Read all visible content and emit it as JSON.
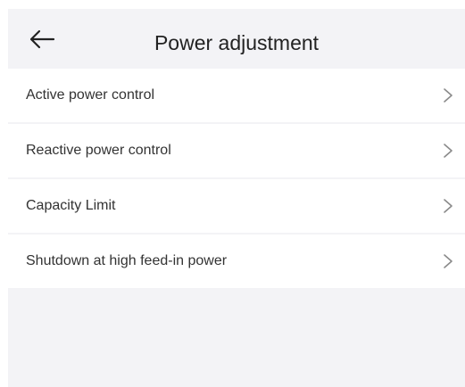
{
  "header": {
    "title": "Power adjustment",
    "back_icon": "arrow-left-icon"
  },
  "menu": {
    "items": [
      {
        "label": "Active power control",
        "icon": "chevron-right-icon"
      },
      {
        "label": "Reactive power control",
        "icon": "chevron-right-icon"
      },
      {
        "label": "Capacity Limit",
        "icon": "chevron-right-icon"
      },
      {
        "label": "Shutdown at high feed-in power",
        "icon": "chevron-right-icon"
      }
    ]
  },
  "colors": {
    "background": "#f3f3f6",
    "row_background": "#ffffff",
    "text": "#333333",
    "chevron": "#8a8a8a"
  }
}
